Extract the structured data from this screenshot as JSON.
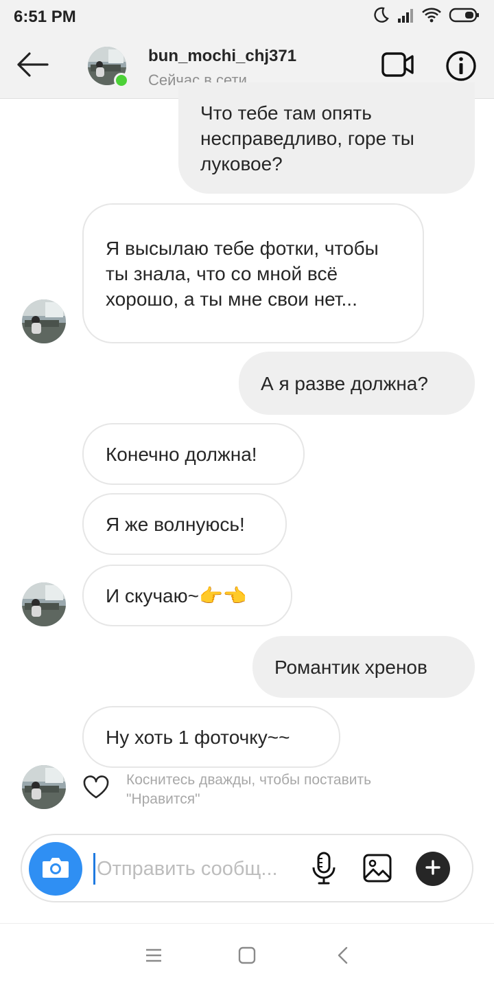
{
  "status_bar": {
    "time": "6:51 PM"
  },
  "header": {
    "username": "bun_mochi_chj371",
    "presence": "Сейчас в сети"
  },
  "messages": [
    {
      "direction": "outgoing",
      "text": "Что тебе там опять несправедливо, горе ты луковое?"
    },
    {
      "direction": "incoming",
      "text": "Я высылаю тебе фотки, чтобы ты знала, что со мной всё хорошо, а ты мне свои нет..."
    },
    {
      "direction": "outgoing",
      "text": "А я разве должна?"
    },
    {
      "direction": "incoming",
      "text": "Конечно должна!"
    },
    {
      "direction": "incoming",
      "text": "Я же волнуюсь!"
    },
    {
      "direction": "incoming",
      "text": "И скучаю~👉👈"
    },
    {
      "direction": "outgoing",
      "text": "Романтик хренов"
    },
    {
      "direction": "incoming",
      "text": "Ну хоть 1 фоточку~~"
    }
  ],
  "like_hint": "Коснитесь дважды, чтобы поставить \"Нравится\"",
  "composer": {
    "placeholder": "Отправить сообщ..."
  },
  "colors": {
    "online": "#4cd137",
    "camera_button": "#2f8ff3",
    "outgoing_bubble": "#efefef",
    "incoming_border": "#e6e6e6"
  },
  "icons": {
    "back": "arrow-left-icon",
    "video": "video-camera-icon",
    "info": "info-icon",
    "camera": "camera-icon",
    "mic": "microphone-icon",
    "gallery": "image-icon",
    "plus": "plus-icon",
    "like": "heart-icon"
  }
}
